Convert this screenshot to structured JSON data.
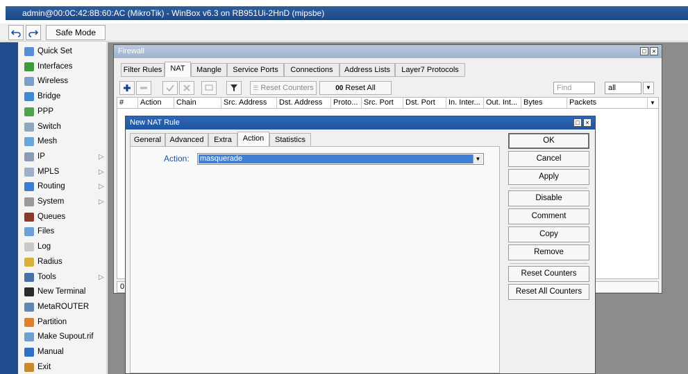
{
  "window": {
    "title": "admin@00:0C:42:8B:60:AC (MikroTik) - WinBox v6.3 on RB951Ui-2HnD (mipsbe)"
  },
  "toolbar": {
    "undo_icon": "undo-icon",
    "redo_icon": "redo-icon",
    "safe_mode_label": "Safe Mode"
  },
  "menu": {
    "items": [
      {
        "label": "Quick Set",
        "icon": "quick-set-icon",
        "color": "#5b8dd6",
        "submenu": false
      },
      {
        "label": "Interfaces",
        "icon": "interfaces-icon",
        "color": "#3d9b3d",
        "submenu": false
      },
      {
        "label": "Wireless",
        "icon": "wireless-icon",
        "color": "#7aa0c9",
        "submenu": false
      },
      {
        "label": "Bridge",
        "icon": "bridge-icon",
        "color": "#3e8ad8",
        "submenu": false
      },
      {
        "label": "PPP",
        "icon": "ppp-icon",
        "color": "#4fa34f",
        "submenu": false
      },
      {
        "label": "Switch",
        "icon": "switch-icon",
        "color": "#8fa6bf",
        "submenu": false
      },
      {
        "label": "Mesh",
        "icon": "mesh-icon",
        "color": "#6ba6d8",
        "submenu": false
      },
      {
        "label": "IP",
        "icon": "ip-icon",
        "color": "#8a9cb5",
        "submenu": true
      },
      {
        "label": "MPLS",
        "icon": "mpls-icon",
        "color": "#9db0c7",
        "submenu": true
      },
      {
        "label": "Routing",
        "icon": "routing-icon",
        "color": "#3a7fd1",
        "submenu": true
      },
      {
        "label": "System",
        "icon": "system-icon",
        "color": "#9a9a9a",
        "submenu": true
      },
      {
        "label": "Queues",
        "icon": "queues-icon",
        "color": "#8b3a2a",
        "submenu": false
      },
      {
        "label": "Files",
        "icon": "files-icon",
        "color": "#6f9fd6",
        "submenu": false
      },
      {
        "label": "Log",
        "icon": "log-icon",
        "color": "#c9c9c9",
        "submenu": false
      },
      {
        "label": "Radius",
        "icon": "radius-icon",
        "color": "#d8b13a",
        "submenu": false
      },
      {
        "label": "Tools",
        "icon": "tools-icon",
        "color": "#4a6fa5",
        "submenu": true
      },
      {
        "label": "New Terminal",
        "icon": "terminal-icon",
        "color": "#2b2b2b",
        "submenu": false
      },
      {
        "label": "MetaROUTER",
        "icon": "metarouter-icon",
        "color": "#5f87b8",
        "submenu": false
      },
      {
        "label": "Partition",
        "icon": "partition-icon",
        "color": "#e0802a",
        "submenu": false
      },
      {
        "label": "Make Supout.rif",
        "icon": "supout-icon",
        "color": "#6fa0d0",
        "submenu": false
      },
      {
        "label": "Manual",
        "icon": "manual-icon",
        "color": "#2f6fc6",
        "submenu": false
      },
      {
        "label": "Exit",
        "icon": "exit-icon",
        "color": "#c88b2a",
        "submenu": false
      }
    ],
    "submenu_arrow": "▷"
  },
  "firewall": {
    "title": "Firewall",
    "tabs": [
      "Filter Rules",
      "NAT",
      "Mangle",
      "Service Ports",
      "Connections",
      "Address Lists",
      "Layer7 Protocols"
    ],
    "active_tab": "NAT",
    "reset_counters": "Reset Counters",
    "reset_all_counters": "Reset All Counters",
    "reset_all_prefix": "00",
    "find_placeholder": "Find",
    "filter_value": "all",
    "columns": [
      "#",
      "Action",
      "Chain",
      "Src. Address",
      "Dst. Address",
      "Proto...",
      "Src. Port",
      "Dst. Port",
      "In. Inter...",
      "Out. Int...",
      "Bytes",
      "Packets"
    ],
    "status": "0"
  },
  "nat_rule": {
    "title": "New NAT Rule",
    "tabs": [
      "General",
      "Advanced",
      "Extra",
      "Action",
      "Statistics"
    ],
    "active_tab": "Action",
    "action_label": "Action:",
    "action_value": "masquerade",
    "buttons": {
      "ok": "OK",
      "cancel": "Cancel",
      "apply": "Apply",
      "disable": "Disable",
      "comment": "Comment",
      "copy": "Copy",
      "remove": "Remove",
      "reset_counters": "Reset Counters",
      "reset_all_counters": "Reset All Counters"
    }
  },
  "colors": {
    "sidebar": "#1f4d8f",
    "titlebar": "#1c4785",
    "selection": "#3f7fd8",
    "field_label": "#1a4e9e"
  }
}
